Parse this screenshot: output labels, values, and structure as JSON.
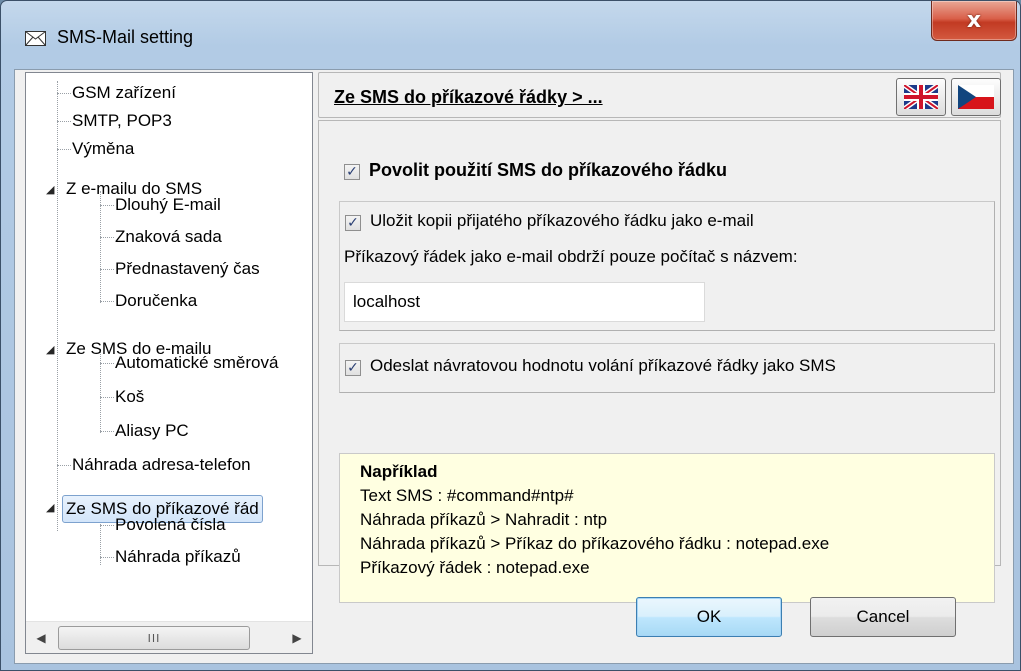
{
  "window": {
    "title": "SMS-Mail setting",
    "close_symbol": "x"
  },
  "tree": {
    "items": [
      {
        "label": "GSM zařízení"
      },
      {
        "label": "SMTP, POP3"
      },
      {
        "label": "Výměna"
      },
      {
        "label": "Z e-mailu do SMS"
      },
      {
        "label": "Dlouhý E-mail"
      },
      {
        "label": "Znaková sada"
      },
      {
        "label": "Přednastavený čas"
      },
      {
        "label": "Doručenka"
      },
      {
        "label": "Ze SMS do e-mailu"
      },
      {
        "label": "Automatické směrová"
      },
      {
        "label": "Koš"
      },
      {
        "label": "Aliasy PC"
      },
      {
        "label": "Náhrada adresa-telefon"
      },
      {
        "label": "Ze SMS do příkazové řád"
      },
      {
        "label": "Povolená čísla"
      },
      {
        "label": "Náhrada příkazů"
      }
    ],
    "scroll_left": "◀",
    "scroll_right": "▶",
    "scroll_thumb": "III"
  },
  "panel": {
    "section_title": "Ze SMS do příkazové řádky  >  ...",
    "enable_label": "Povolit použití SMS do příkazového řádku",
    "save_copy_label": "Uložit kopii přijatého příkazového řádku jako e-mail",
    "computer_label": "Příkazový řádek jako e-mail obdrží pouze počítač s názvem:",
    "computer_value": "localhost",
    "send_return_label": "Odeslat návratovou hodnotu volání příkazové řádky jako SMS",
    "checkmark": "✓"
  },
  "example": {
    "heading": "Například",
    "lines": [
      "Text SMS : #command#ntp#",
      "Náhrada příkazů > Nahradit : ntp",
      "Náhrada příkazů > Příkaz do příkazového řádku : notepad.exe",
      "Příkazový řádek : notepad.exe"
    ]
  },
  "buttons": {
    "ok": "OK",
    "cancel": "Cancel"
  },
  "colors": {
    "example_bg": "#ffffe1",
    "selection_border": "#7da2ce",
    "close_red": "#c23a23"
  }
}
